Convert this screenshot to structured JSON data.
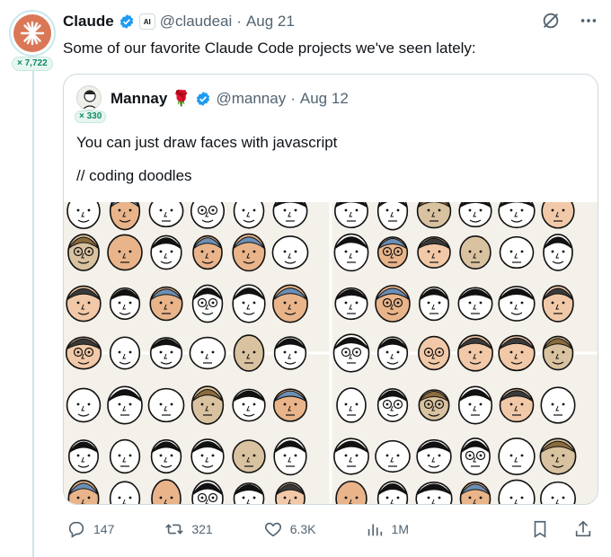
{
  "tweet": {
    "author_name": "Claude",
    "affiliation_badge": "AI",
    "handle": "@claudeai",
    "date": "Aug 21",
    "followers_badge": "× 7,722",
    "text": "Some of our favorite Claude Code projects we've seen lately:",
    "icons": {
      "grok": "grok-icon",
      "more": "more-icon",
      "verified": "verified-icon"
    }
  },
  "quote": {
    "author_name": "Mannay",
    "emoji": "🌹",
    "handle": "@mannay",
    "date": "Aug 12",
    "followers_badge": "× 330",
    "line1": "You can just draw faces with javascript",
    "line2": "// coding doodles"
  },
  "actions": {
    "replies": "147",
    "reposts": "321",
    "likes": "6.3K",
    "views": "1M"
  },
  "colors": {
    "accent": "#1d9bf0",
    "claude_brand": "#d97757",
    "muted": "#536471"
  }
}
